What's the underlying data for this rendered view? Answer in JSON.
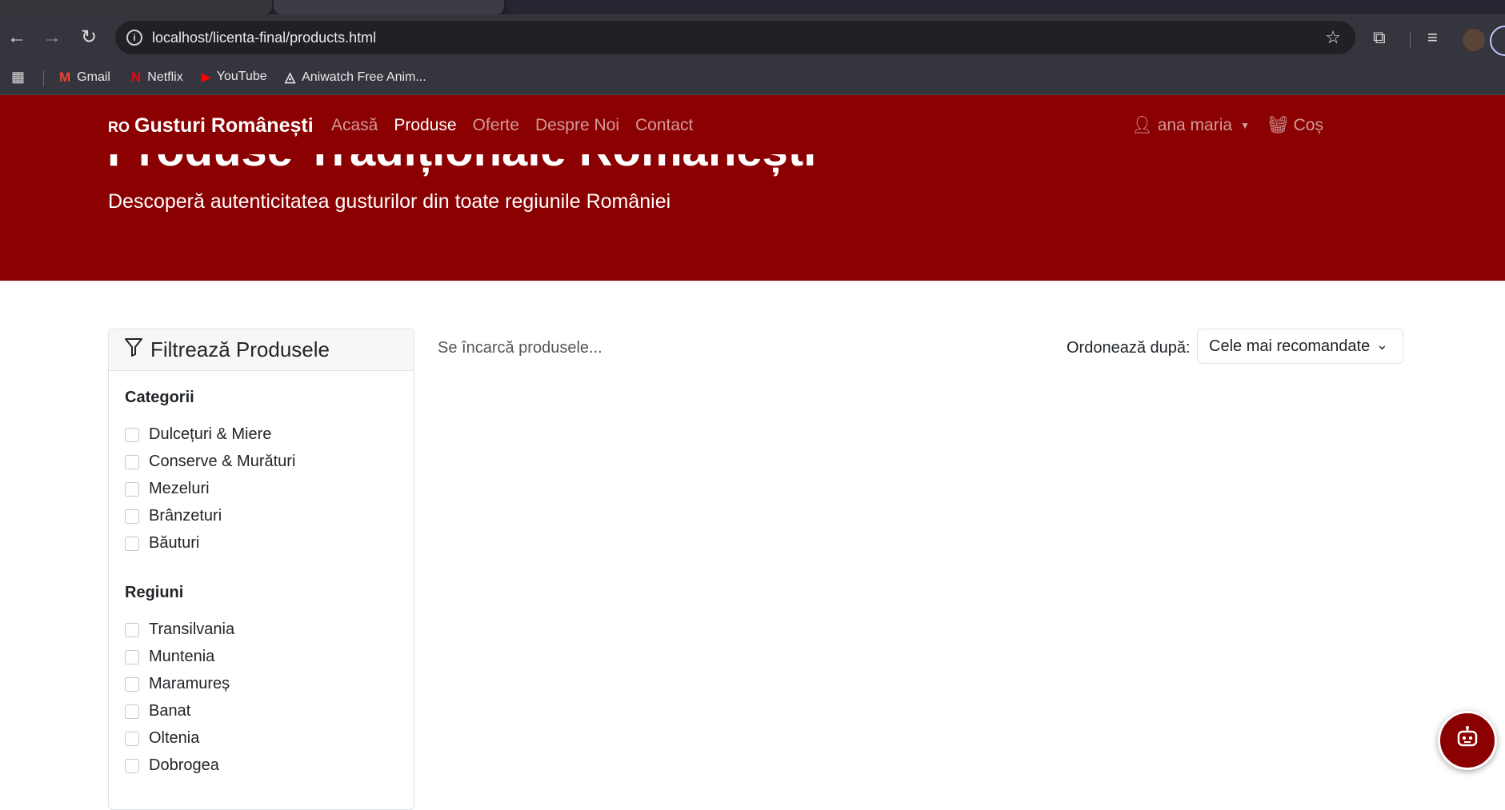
{
  "browser": {
    "url": "localhost/licenta-final/products.html",
    "bookmarks": [
      {
        "label": "Gmail",
        "icon": "gmail-icon",
        "glyph": "M"
      },
      {
        "label": "Netflix",
        "icon": "netflix-icon",
        "glyph": "N"
      },
      {
        "label": "YouTube",
        "icon": "youtube-icon",
        "glyph": "▶"
      },
      {
        "label": "Aniwatch Free Anim...",
        "icon": "aniwatch-icon",
        "glyph": "◬"
      }
    ]
  },
  "navbar": {
    "brand_prefix": "RO",
    "brand": "Gusturi Românești",
    "links": [
      "Acasă",
      "Produse",
      "Oferte",
      "Despre Noi",
      "Contact"
    ],
    "active_link": "Produse",
    "user": "ana maria",
    "cart": "Coș"
  },
  "hero": {
    "title": "Produse Tradiționale Românești",
    "subtitle": "Descoperă autenticitatea gusturilor din toate regiunile României"
  },
  "filters": {
    "header": "Filtrează Produsele",
    "categories_title": "Categorii",
    "categories": [
      "Dulcețuri & Miere",
      "Conserve & Murături",
      "Mezeluri",
      "Brânzeturi",
      "Băuturi"
    ],
    "regions_title": "Regiuni",
    "regions": [
      "Transilvania",
      "Muntenia",
      "Maramureș",
      "Banat",
      "Oltenia",
      "Dobrogea"
    ]
  },
  "products": {
    "loading_text": "Se încarcă produsele...",
    "sort_label": "Ordonează după:",
    "sort_value": "Cele mai recomandate"
  },
  "colors": {
    "brand_red": "#8b0000"
  }
}
